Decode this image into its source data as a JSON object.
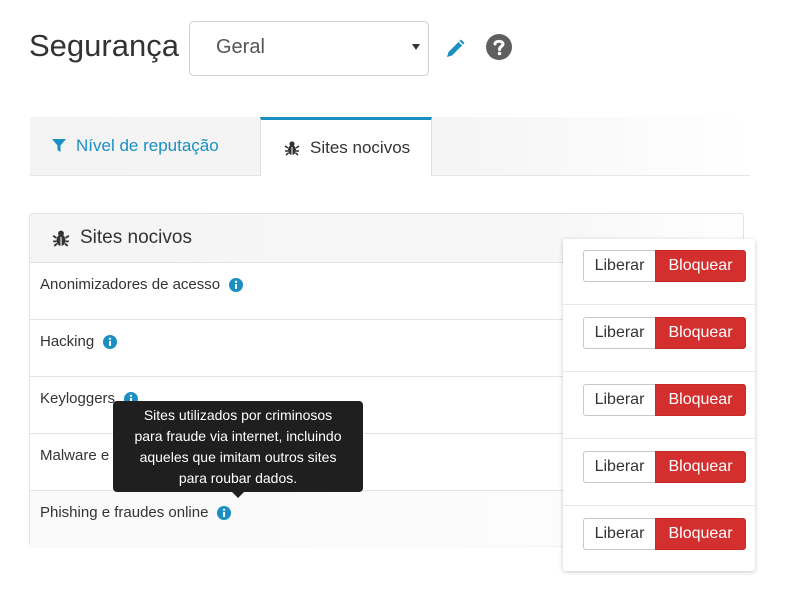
{
  "header": {
    "title": "Segurança",
    "profile_select": {
      "value": "Geral"
    },
    "edit_icon": "pencil-icon",
    "help_icon": "question-circle-icon"
  },
  "tabs": [
    {
      "label": "Nível de reputação",
      "icon": "filter-icon",
      "active": false
    },
    {
      "label": "Sites nocivos",
      "icon": "bug-icon",
      "active": true
    }
  ],
  "panel": {
    "title": "Sites nocivos",
    "icon": "bug-icon",
    "rows": [
      {
        "label": "Anonimizadores de acesso"
      },
      {
        "label": "Hacking"
      },
      {
        "label": "Keyloggers"
      },
      {
        "label": "Malware e s"
      },
      {
        "label": "Phishing e fraudes online"
      }
    ]
  },
  "actions": {
    "allow_label": "Liberar",
    "block_label": "Bloquear"
  },
  "tooltip": {
    "lines": [
      "Sites utilizados por criminosos",
      "para fraude via internet, incluindo",
      "aqueles que imitam outros sites",
      "para roubar dados."
    ]
  },
  "colors": {
    "accent": "#1a8fc1",
    "block": "#d32f2f",
    "tooltip_bg": "#1f1f1f"
  }
}
